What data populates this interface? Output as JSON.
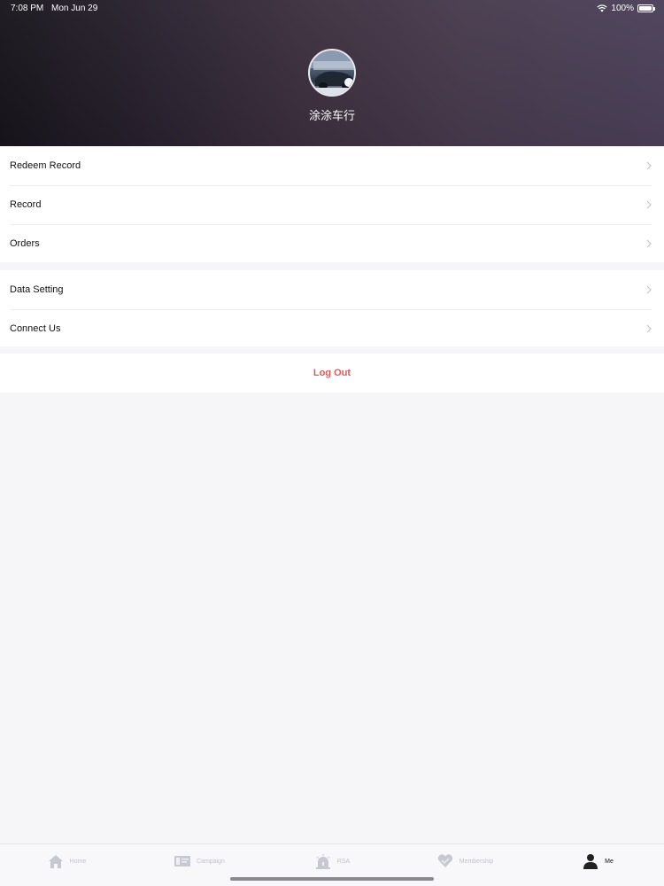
{
  "status_bar": {
    "time": "7:08 PM",
    "date": "Mon Jun 29",
    "battery": "100%"
  },
  "profile": {
    "name": "涂涂车行"
  },
  "menu_groups": [
    {
      "items": [
        {
          "label": "Redeem Record"
        },
        {
          "label": "Record"
        },
        {
          "label": "Orders"
        }
      ]
    },
    {
      "items": [
        {
          "label": "Data Setting"
        },
        {
          "label": "Connect Us"
        }
      ]
    }
  ],
  "logout": {
    "label": "Log Out"
  },
  "tabbar": {
    "tabs": [
      {
        "label": "Home",
        "icon": "home-icon"
      },
      {
        "label": "Campaign",
        "icon": "campaign-icon"
      },
      {
        "label": "RSA",
        "icon": "rsa-icon"
      },
      {
        "label": "Membership",
        "icon": "membership-icon"
      },
      {
        "label": "Me",
        "icon": "profile-icon",
        "active": true
      }
    ]
  },
  "colors": {
    "accent_logout": "#e05a5a",
    "header_start": "#17141b",
    "header_end": "#4a3f58"
  }
}
